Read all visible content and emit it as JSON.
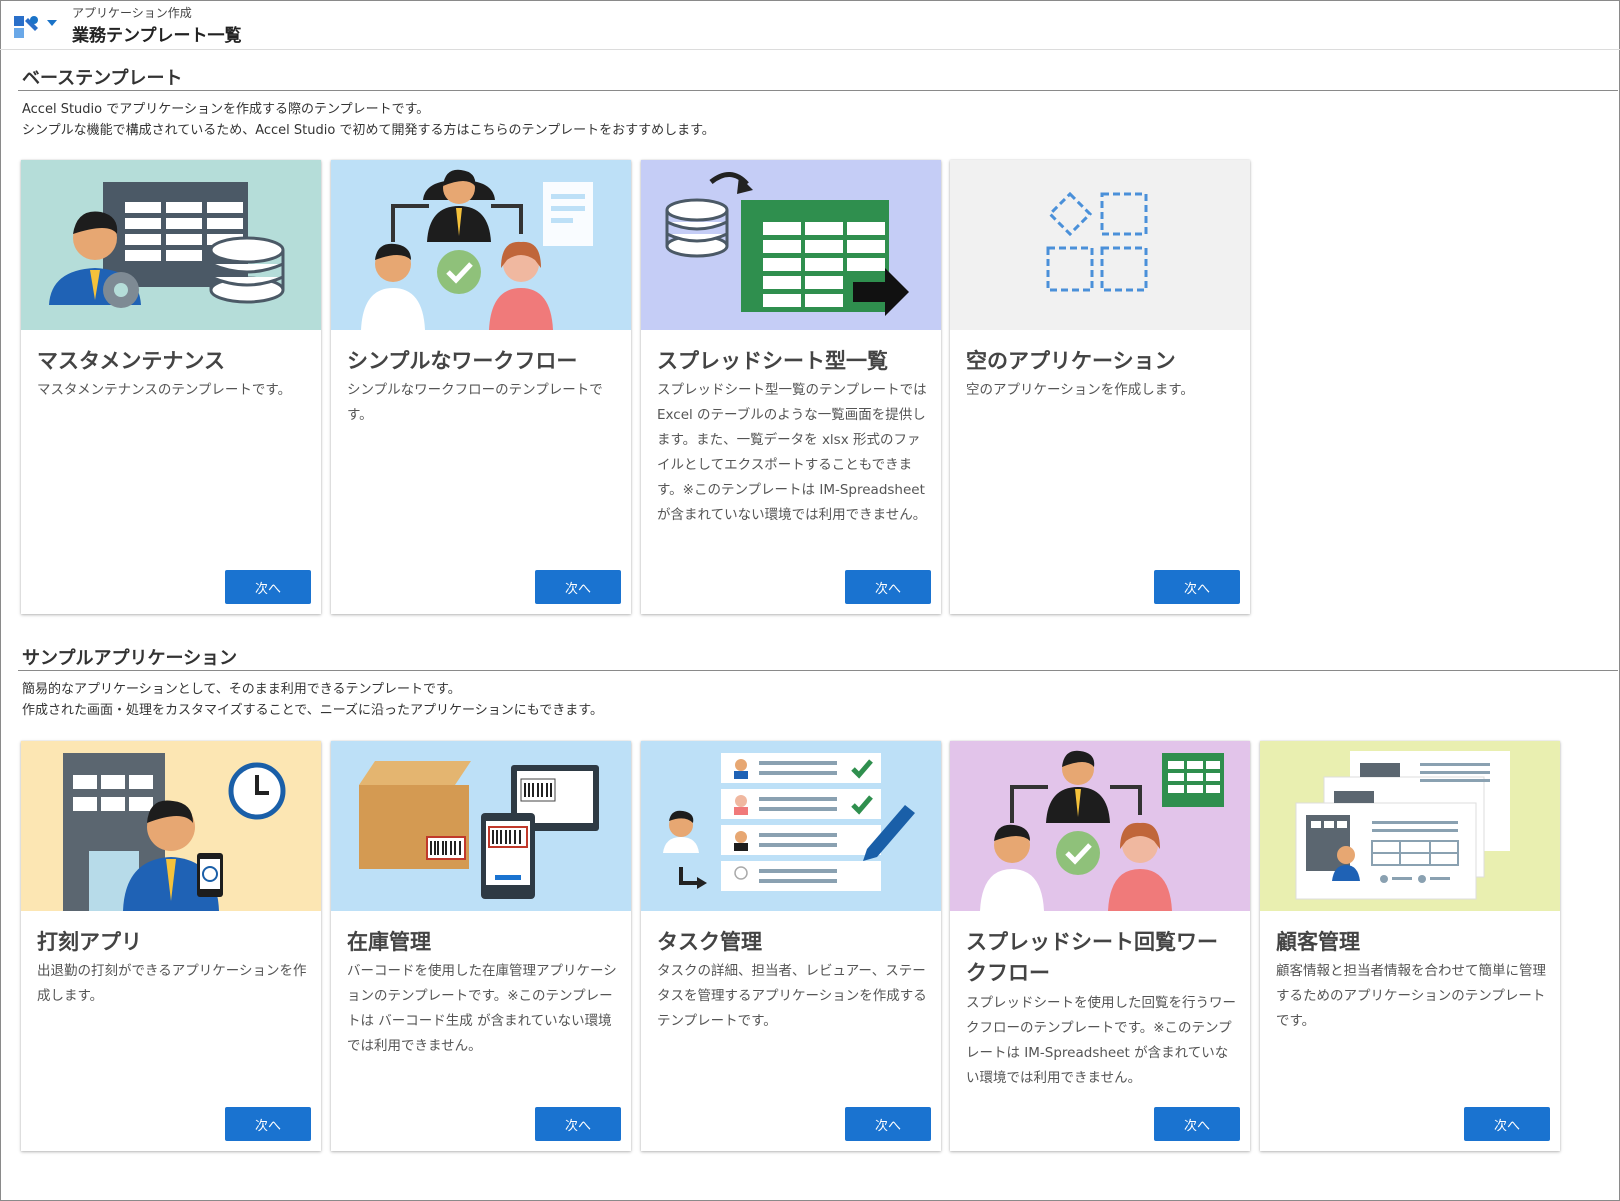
{
  "header": {
    "breadcrumb": "アプリケーション作成",
    "title": "業務テンプレート一覧"
  },
  "sections": [
    {
      "title": "ベーステンプレート",
      "desc_lines": [
        "Accel Studio でアプリケーションを作成する際のテンプレートです。",
        "シンプルな機能で構成されているため、Accel Studio で初めて開発する方はこちらのテンプレートをおすすめします。"
      ],
      "cards": [
        {
          "title": "マスタメンテナンス",
          "text": "マスタメンテナンスのテンプレートです。",
          "button": "次へ",
          "bg": "#b5ddd9"
        },
        {
          "title": "シンプルなワークフロー",
          "text": "シンプルなワークフローのテンプレートです。",
          "button": "次へ",
          "bg": "#bde0f7"
        },
        {
          "title": "スプレッドシート型一覧",
          "text": "スプレッドシート型一覧のテンプレートでは Excel のテーブルのような一覧画面を提供します。また、一覧データを xlsx 形式のファイルとしてエクスポートすることもできます。※このテンプレートは IM-Spreadsheet が含まれていない環境では利用できません。",
          "button": "次へ",
          "bg": "#c5cdf6"
        },
        {
          "title": "空のアプリケーション",
          "text": "空のアプリケーションを作成します。",
          "button": "次へ",
          "bg": "#f1f1f1"
        }
      ]
    },
    {
      "title": "サンプルアプリケーション",
      "desc_lines": [
        "簡易的なアプリケーションとして、そのまま利用できるテンプレートです。",
        "作成された画面・処理をカスタマイズすることで、ニーズに沿ったアプリケーションにもできます。"
      ],
      "cards": [
        {
          "title": "打刻アプリ",
          "text": "出退勤の打刻ができるアプリケーションを作成します。",
          "button": "次へ",
          "bg": "#fce6b3"
        },
        {
          "title": "在庫管理",
          "text": "バーコードを使用した在庫管理アプリケーションのテンプレートです。※このテンプレートは バーコード生成 が含まれていない環境では利用できません。",
          "button": "次へ",
          "bg": "#bde0f7"
        },
        {
          "title": "タスク管理",
          "text": "タスクの詳細、担当者、レビュアー、ステータスを管理するアプリケーションを作成するテンプレートです。",
          "button": "次へ",
          "bg": "#bde0f7"
        },
        {
          "title": "スプレッドシート回覧ワークフロー",
          "text": "スプレッドシートを使用した回覧を行うワークフローのテンプレートです。※このテンプレートは IM-Spreadsheet が含まれていない環境では利用できません。",
          "button": "次へ",
          "bg": "#e2c4ea"
        },
        {
          "title": "顧客管理",
          "text": "顧客情報と担当者情報を合わせて簡単に管理するためのアプリケーションのテンプレートです。",
          "button": "次へ",
          "bg": "#e9efb0"
        }
      ]
    }
  ]
}
